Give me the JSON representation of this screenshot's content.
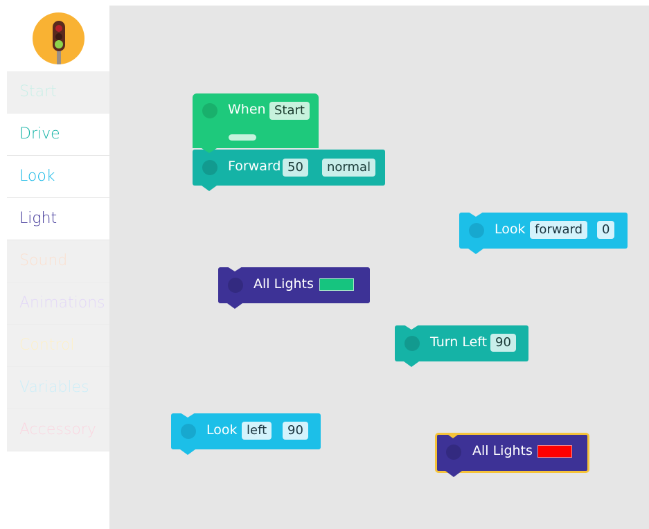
{
  "colors": {
    "start_block": "#1ec97c",
    "drive_block": "#15b3a6",
    "look_block": "#1cbfe8",
    "light_block": "#3d3296",
    "highlight": "#f5c33a",
    "green_swatch": "#16c47f",
    "red_swatch": "#ff0000",
    "logo_bg": "#f9b233"
  },
  "logo": {
    "icon": "traffic-light-icon"
  },
  "categories": [
    {
      "label": "Start",
      "color": "#c8efe7",
      "active": false
    },
    {
      "label": "Drive",
      "color": "#14b3a6",
      "active": true
    },
    {
      "label": "Look",
      "color": "#17b8e6",
      "active": true
    },
    {
      "label": "Light",
      "color": "#3d3296",
      "active": true
    },
    {
      "label": "Sound",
      "color": "#fbe0d0",
      "active": false
    },
    {
      "label": "Animations",
      "color": "#e2d7f7",
      "active": false
    },
    {
      "label": "Control",
      "color": "#fdf0c8",
      "active": false
    },
    {
      "label": "Variables",
      "color": "#cbeef8",
      "active": false
    },
    {
      "label": "Accessory",
      "color": "#fad6e0",
      "active": false
    }
  ],
  "blocks": {
    "when_start": {
      "label": "When",
      "event": "Start"
    },
    "forward": {
      "label": "Forward",
      "distance": "50",
      "speed": "normal"
    },
    "look_forward": {
      "label": "Look",
      "direction": "forward",
      "angle": "0"
    },
    "all_lights_green": {
      "label": "All Lights",
      "color": "green"
    },
    "turn_left": {
      "label": "Turn Left",
      "angle": "90"
    },
    "look_left": {
      "label": "Look",
      "direction": "left",
      "angle": "90"
    },
    "all_lights_red": {
      "label": "All Lights",
      "color": "red"
    }
  }
}
